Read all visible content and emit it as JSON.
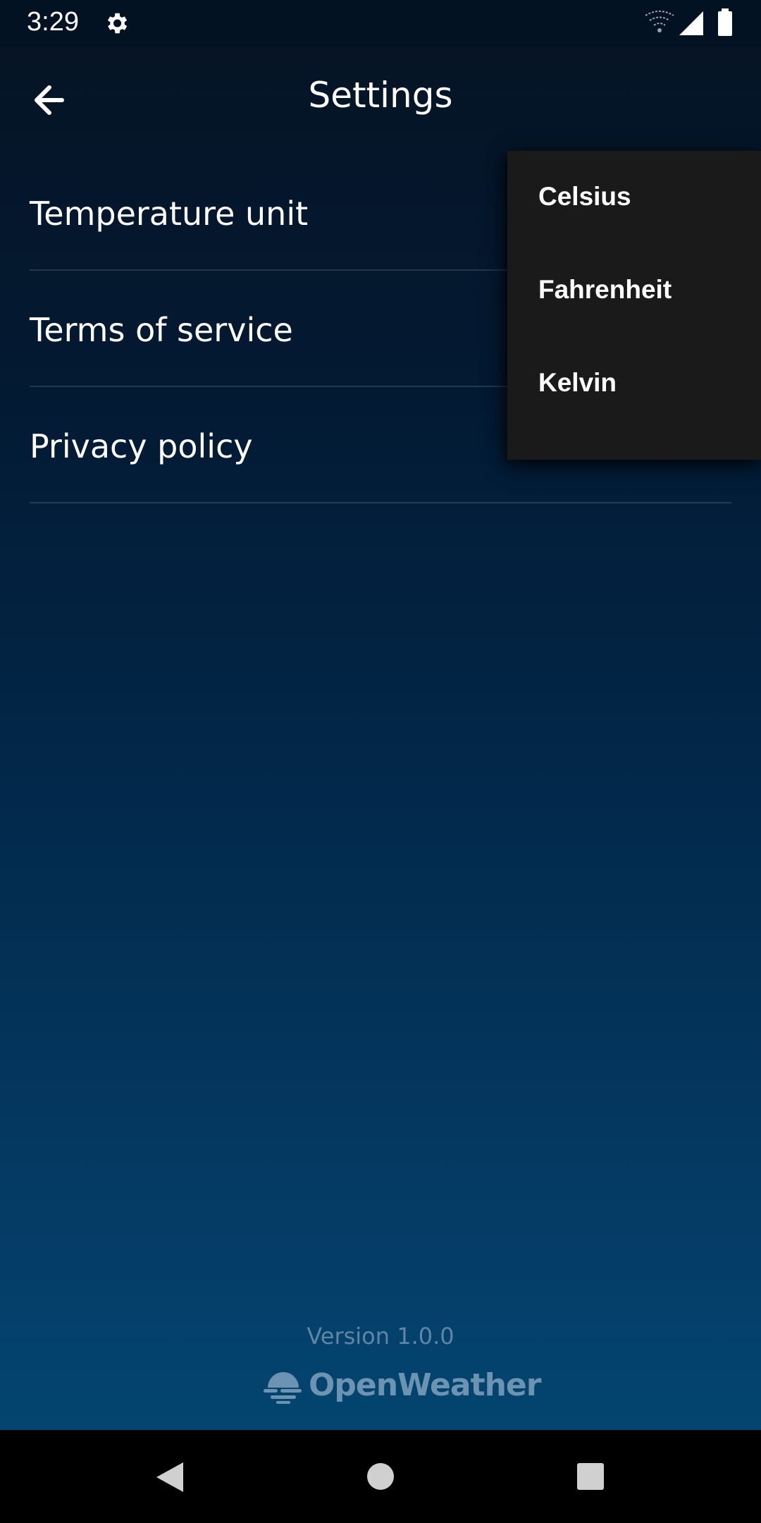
{
  "status_bar": {
    "time": "3:29",
    "icons": [
      "settings-gear-icon",
      "wifi-icon",
      "signal-icon",
      "battery-icon"
    ]
  },
  "app_bar": {
    "title": "Settings",
    "back_icon": "arrow-back-icon"
  },
  "settings": {
    "items": [
      {
        "label": "Temperature unit"
      },
      {
        "label": "Terms of service"
      },
      {
        "label": "Privacy policy"
      }
    ]
  },
  "unit_menu": {
    "options": [
      "Celsius",
      "Fahrenheit",
      "Kelvin"
    ]
  },
  "footer": {
    "version": "Version 1.0.0",
    "brand": "OpenWeather"
  },
  "nav_bar": {
    "icons": [
      "nav-back-icon",
      "nav-home-icon",
      "nav-recents-icon"
    ]
  },
  "colors": {
    "background_top": "#061324",
    "background_bottom": "#034570",
    "menu_background": "#1a1a1a",
    "footer_text": "#5f86a4",
    "brand": "#6c93b2"
  }
}
